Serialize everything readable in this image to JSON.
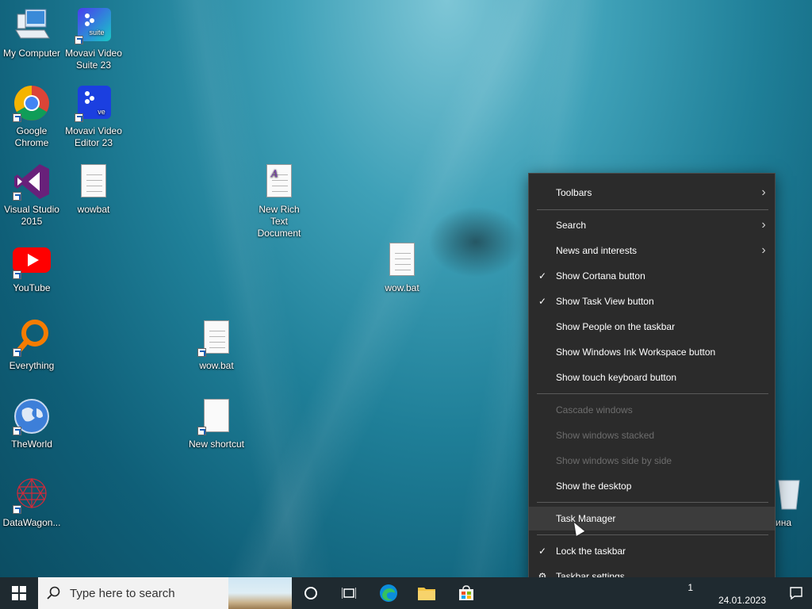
{
  "desktop_icons": [
    {
      "name": "desktop-icon-my-computer",
      "label": "My Computer"
    },
    {
      "name": "desktop-icon-movavi-suite",
      "label": "Movavi Video Suite 23",
      "badge": "suite"
    },
    {
      "name": "desktop-icon-google-chrome",
      "label": "Google Chrome"
    },
    {
      "name": "desktop-icon-movavi-editor",
      "label": "Movavi Video Editor 23",
      "badge": "ve"
    },
    {
      "name": "desktop-icon-visual-studio",
      "label": "Visual Studio 2015"
    },
    {
      "name": "desktop-icon-wowbat",
      "label": "wowbat"
    },
    {
      "name": "desktop-icon-rtf",
      "label": "New Rich Text Document"
    },
    {
      "name": "desktop-icon-youtube",
      "label": "YouTube"
    },
    {
      "name": "desktop-icon-wow-bat-1",
      "label": "wow.bat"
    },
    {
      "name": "desktop-icon-everything",
      "label": "Everything"
    },
    {
      "name": "desktop-icon-wow-bat-2",
      "label": "wow.bat"
    },
    {
      "name": "desktop-icon-theworld",
      "label": "TheWorld"
    },
    {
      "name": "desktop-icon-new-shortcut",
      "label": "New shortcut"
    },
    {
      "name": "desktop-icon-datawagon",
      "label": "DataWagon..."
    },
    {
      "name": "desktop-icon-recycle",
      "label": "ина"
    }
  ],
  "menu": {
    "items": [
      {
        "label": "Toolbars",
        "submenu": true
      },
      {
        "label": "Search",
        "submenu": true
      },
      {
        "label": "News and interests",
        "submenu": true
      },
      {
        "label": "Show Cortana button",
        "checked": true
      },
      {
        "label": "Show Task View button",
        "checked": true
      },
      {
        "label": "Show People on the taskbar"
      },
      {
        "label": "Show Windows Ink Workspace button"
      },
      {
        "label": "Show touch keyboard button"
      },
      {
        "label": "Cascade windows",
        "disabled": true
      },
      {
        "label": "Show windows stacked",
        "disabled": true
      },
      {
        "label": "Show windows side by side",
        "disabled": true
      },
      {
        "label": "Show the desktop"
      },
      {
        "label": "Task Manager",
        "hover": true
      },
      {
        "label": "Lock the taskbar",
        "checked": true
      },
      {
        "label": "Taskbar settings",
        "icon": "gear-icon"
      }
    ]
  },
  "taskbar": {
    "search_placeholder": "Type here to search",
    "date": "24.01.2023",
    "time_fragment": "1"
  },
  "colors": {
    "menu_bg": "#2b2b2b",
    "menu_hover": "#3c3c3c",
    "taskbar_bg": "#1f2a30"
  }
}
